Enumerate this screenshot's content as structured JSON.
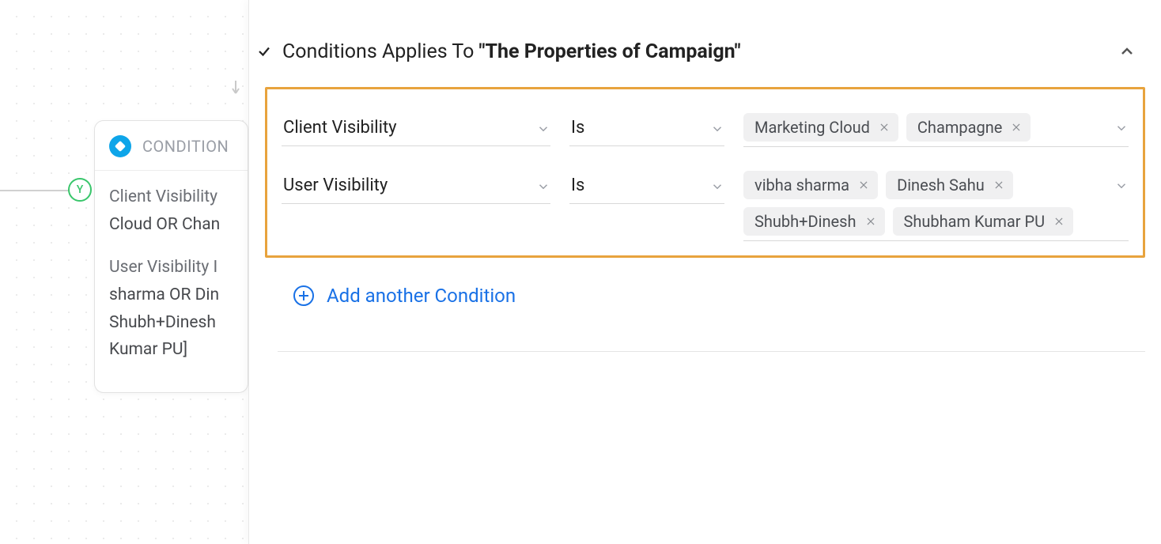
{
  "node": {
    "header_label": "CONDITION",
    "y_badge": "Y",
    "summary": {
      "cond1_line1": "Client Visibility",
      "cond1_line2": "Cloud OR Chan",
      "cond2_line1": "User Visibility I",
      "cond2_line2": "sharma OR Din",
      "cond2_line3": "Shubh+Dinesh",
      "cond2_line4": "Kumar PU]"
    }
  },
  "panel": {
    "title_prefix": "Conditions Applies To ",
    "title_bold": "\"The Properties of Campaign\"",
    "add_label": "Add another Condition"
  },
  "conditions": [
    {
      "field": "Client Visibility",
      "operator": "Is",
      "values": [
        "Marketing Cloud",
        "Champagne"
      ]
    },
    {
      "field": "User Visibility",
      "operator": "Is",
      "values": [
        "vibha sharma",
        "Dinesh Sahu",
        "Shubh+Dinesh",
        "Shubham Kumar PU"
      ]
    }
  ]
}
